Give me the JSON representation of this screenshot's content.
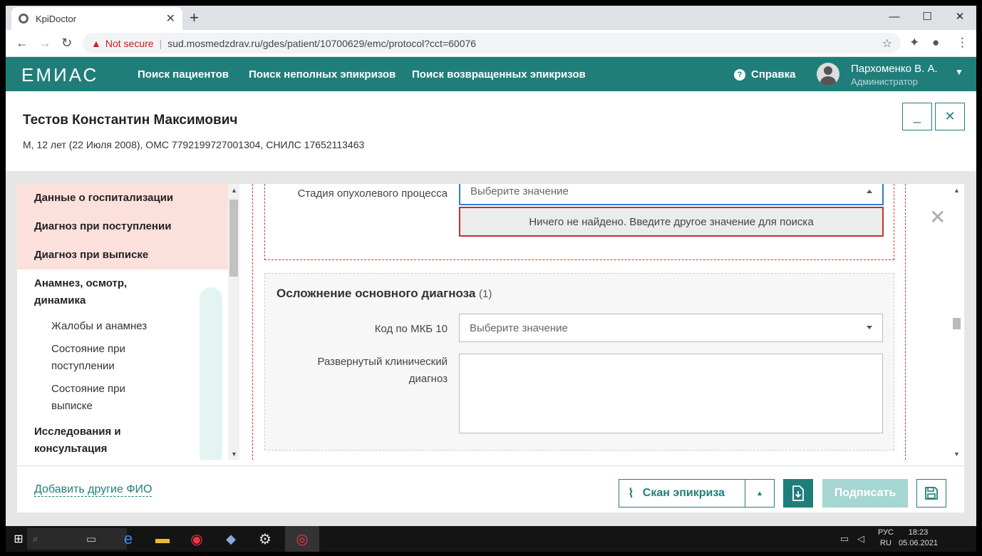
{
  "browser": {
    "tab_title": "KpiDoctor",
    "not_secure": "Not secure",
    "url": "sud.mosmedzdrav.ru/gdes/patient/10700629/emc/protocol?cct=60076"
  },
  "header": {
    "logo": "ЕМИАС",
    "menu": [
      "Поиск пациентов",
      "Поиск неполных эпикризов",
      "Поиск возвращенных эпикризов"
    ],
    "help": "Справка",
    "user_name": "Пархоменко В. А.",
    "user_role": "Администратор"
  },
  "patient": {
    "name": "Тестов Константин Максимович",
    "info": "М, 12 лет (22 Июля 2008), ОМС 7792199727001304, СНИЛС 17652113463"
  },
  "sidebar": {
    "items": [
      {
        "label": "Данные о госпитализации"
      },
      {
        "label": "Диагноз при поступлении"
      },
      {
        "label": "Диагноз при выписке"
      },
      {
        "label": "Анамнез, осмотр,"
      },
      {
        "label": "динамика"
      },
      {
        "label": "Исследования и"
      },
      {
        "label": "консультация"
      }
    ],
    "subitems": [
      "Жалобы и анамнез",
      "Состояние при",
      "поступлении",
      "Состояние при",
      "выписке"
    ]
  },
  "form": {
    "stage_label": "Стадия опухолевого процесса",
    "stage_placeholder": "Выберите значение",
    "no_results": "Ничего не найдено. Введите другое значение для поиска",
    "section_title": "Осложнение основного диагноза",
    "section_count": "(1)",
    "mkb_label": "Код по МКБ 10",
    "mkb_placeholder": "Выберите значение",
    "clinical_label_1": "Развернутый клинический",
    "clinical_label_2": "диагноз"
  },
  "footer": {
    "add_fio": "Добавить другие ФИО",
    "scan": "Скан эпикриза",
    "sign": "Подписать"
  },
  "taskbar": {
    "time": "18:23",
    "date": "05.06.2021",
    "lang1": "РУС",
    "lang2": "RU"
  }
}
